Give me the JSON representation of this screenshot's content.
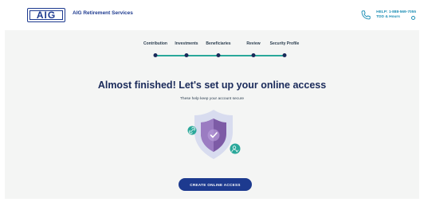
{
  "header": {
    "logo_text": "AIG",
    "brand_name": "AIG Retirement Services",
    "help_line": "HELP: 1-888-569-7055",
    "tdd_hours": "TDD & Hours"
  },
  "stepper": {
    "steps": [
      {
        "label": "Contribution"
      },
      {
        "label": "Investments"
      },
      {
        "label": "Beneficiaries"
      },
      {
        "label": "Review"
      },
      {
        "label": "Security Profile"
      }
    ],
    "current_step": 5
  },
  "main": {
    "headline": "Almost finished! Let's set up your online access",
    "subline": "These help keep your account secure",
    "cta_label": "CREATE ONLINE ACCESS"
  },
  "colors": {
    "brand_navy": "#1d3a8f",
    "accent_teal": "#2aa89a",
    "shield_purple": "#7d5ba6",
    "background_gray": "#f4f5f4"
  },
  "icons": [
    "phone-icon",
    "chevron-icon",
    "link-icon",
    "user-icon",
    "shield-check-icon"
  ]
}
